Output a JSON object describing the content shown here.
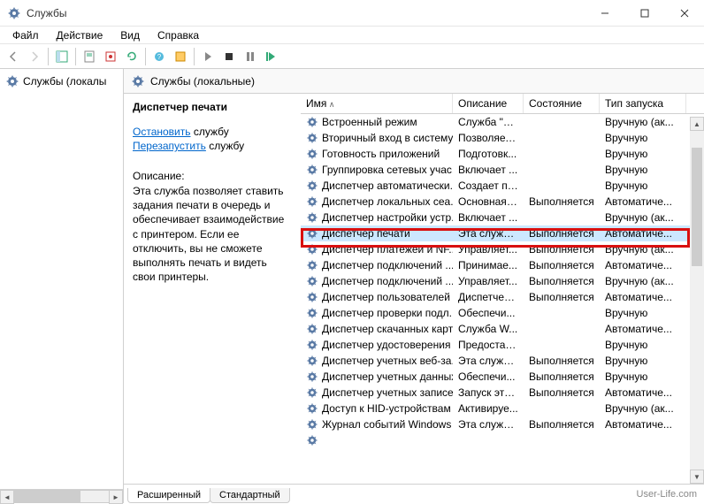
{
  "window": {
    "title": "Службы"
  },
  "menu": {
    "file": "Файл",
    "action": "Действие",
    "view": "Вид",
    "help": "Справка"
  },
  "tree": {
    "root": "Службы (локалы"
  },
  "panel_header": "Службы (локальные)",
  "detail": {
    "name": "Диспетчер печати",
    "stop": "Остановить",
    "restart": "Перезапустить",
    "svc_word": "службу",
    "desc_label": "Описание:",
    "desc": "Эта служба позволяет ставить задания печати в очередь и обеспечивает взаимодействие с принтером. Если ее отключить, вы не сможете выполнять печать и видеть свои принтеры."
  },
  "columns": {
    "name": "Имя",
    "desc": "Описание",
    "state": "Состояние",
    "startup": "Тип запуска"
  },
  "services": [
    {
      "name": "Встроенный режим",
      "desc": "Служба \"B...",
      "state": "",
      "startup": "Вручную (ак..."
    },
    {
      "name": "Вторичный вход в систему",
      "desc": "Позволяет ...",
      "state": "",
      "startup": "Вручную"
    },
    {
      "name": "Готовность приложений",
      "desc": "Подготовк...",
      "state": "",
      "startup": "Вручную"
    },
    {
      "name": "Группировка сетевых учас...",
      "desc": "Включает ...",
      "state": "",
      "startup": "Вручную"
    },
    {
      "name": "Диспетчер автоматически...",
      "desc": "Создает по...",
      "state": "",
      "startup": "Вручную"
    },
    {
      "name": "Диспетчер локальных сеа...",
      "desc": "Основная ...",
      "state": "Выполняется",
      "startup": "Автоматиче..."
    },
    {
      "name": "Диспетчер настройки устр...",
      "desc": "Включает ...",
      "state": "",
      "startup": "Вручную (ак..."
    },
    {
      "name": "Диспетчер печати",
      "desc": "Эта служб...",
      "state": "Выполняется",
      "startup": "Автоматиче...",
      "selected": true
    },
    {
      "name": "Диспетчер платежей и NF...",
      "desc": "Управляет...",
      "state": "Выполняется",
      "startup": "Вручную (ак..."
    },
    {
      "name": "Диспетчер подключений ...",
      "desc": "Принимае...",
      "state": "Выполняется",
      "startup": "Автоматиче..."
    },
    {
      "name": "Диспетчер подключений ...",
      "desc": "Управляет...",
      "state": "Выполняется",
      "startup": "Вручную (ак..."
    },
    {
      "name": "Диспетчер пользователей",
      "desc": "Диспетчер...",
      "state": "Выполняется",
      "startup": "Автоматиче..."
    },
    {
      "name": "Диспетчер проверки подл...",
      "desc": "Обеспечи...",
      "state": "",
      "startup": "Вручную"
    },
    {
      "name": "Диспетчер скачанных карт",
      "desc": "Служба W...",
      "state": "",
      "startup": "Автоматиче..."
    },
    {
      "name": "Диспетчер удостоверения ...",
      "desc": "Предостав...",
      "state": "",
      "startup": "Вручную"
    },
    {
      "name": "Диспетчер учетных веб-за...",
      "desc": "Эта служб...",
      "state": "Выполняется",
      "startup": "Вручную"
    },
    {
      "name": "Диспетчер учетных данных",
      "desc": "Обеспечи...",
      "state": "Выполняется",
      "startup": "Вручную"
    },
    {
      "name": "Диспетчер учетных записе...",
      "desc": "Запуск это...",
      "state": "Выполняется",
      "startup": "Автоматиче..."
    },
    {
      "name": "Доступ к HID-устройствам",
      "desc": "Активируе...",
      "state": "",
      "startup": "Вручную (ак..."
    },
    {
      "name": "Журнал событий Windows",
      "desc": "Эта служб...",
      "state": "Выполняется",
      "startup": "Автоматиче..."
    },
    {
      "name": "",
      "desc": "",
      "state": "",
      "startup": ""
    }
  ],
  "tabs": {
    "extended": "Расширенный",
    "standard": "Стандартный"
  },
  "watermark": "User-Life.com"
}
